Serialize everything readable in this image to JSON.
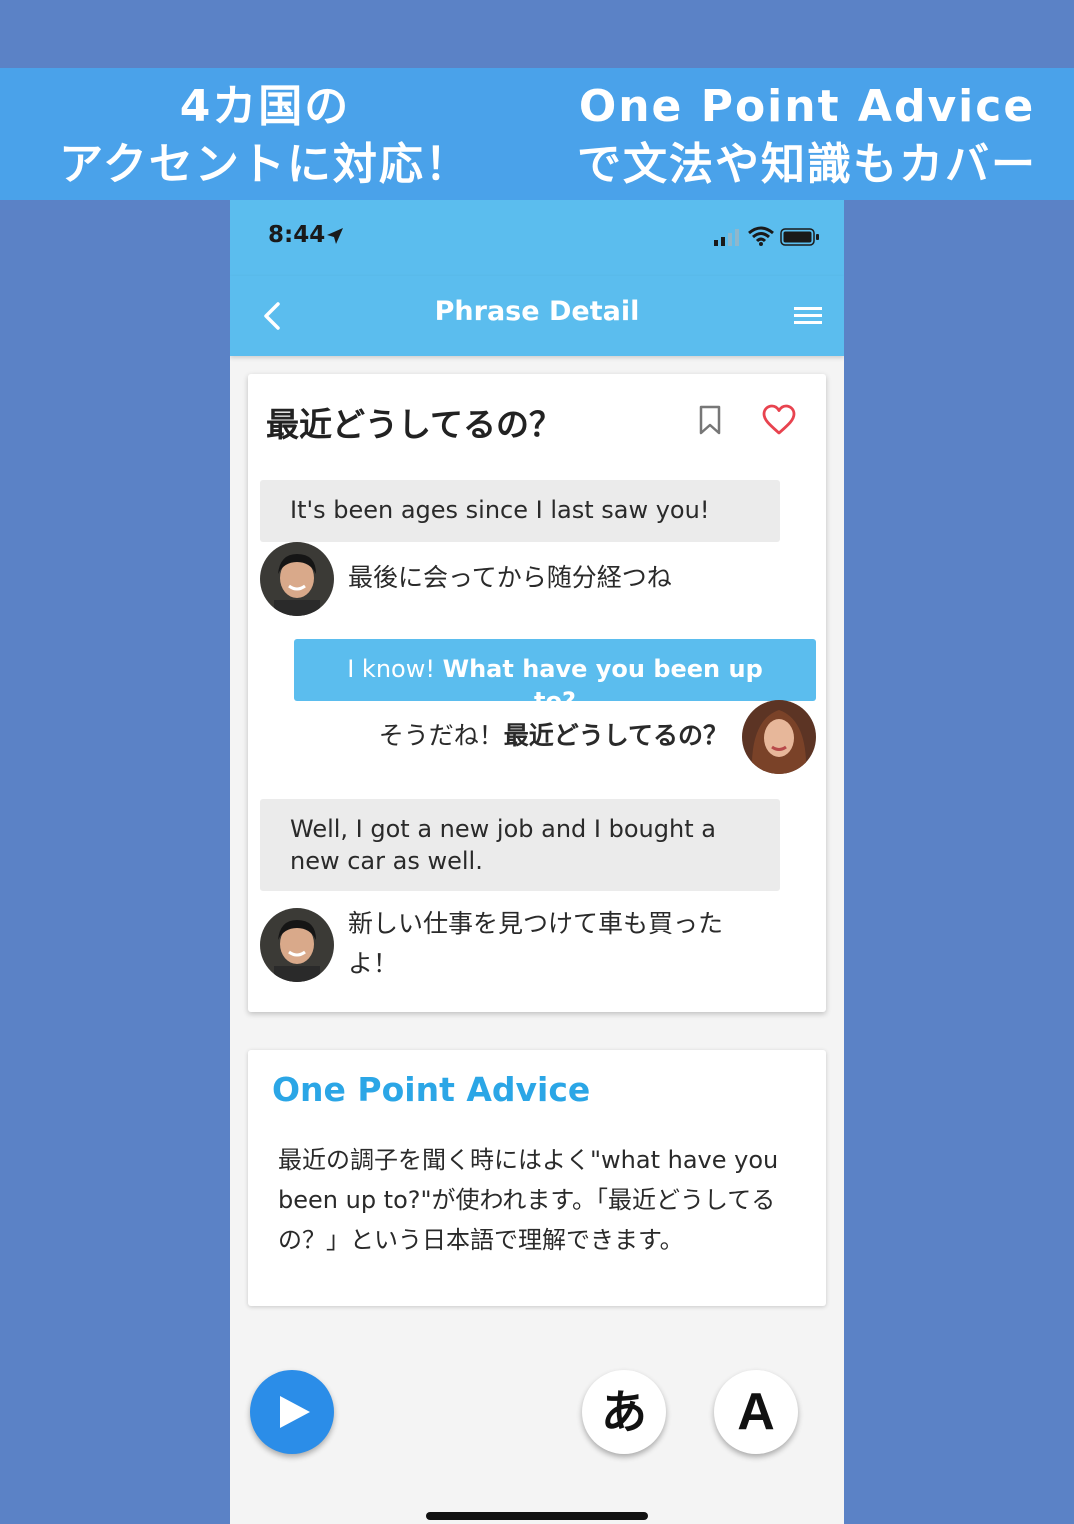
{
  "banner": {
    "left_line1": "4カ国の",
    "left_line2": "アクセントに対応！",
    "right_line1": "One Point Advice",
    "right_line2": "で文法や知識もカバー"
  },
  "status": {
    "time": "8:44"
  },
  "nav": {
    "title": "Phrase Detail"
  },
  "phrase": {
    "title": "最近どうしてるの？"
  },
  "dialog": [
    {
      "en": "It's been ages since I last saw you!",
      "ja": "最後に会ってから随分経つね"
    },
    {
      "en_plain": "I know! ",
      "en_strong": "What have you been up to?",
      "ja_plain": "そうだね！",
      "ja_strong": "最近どうしてるの？"
    },
    {
      "en": "Well, I got a new job and I bought a new car as well.",
      "ja": "新しい仕事を見つけて車も買ったよ！"
    }
  ],
  "advice": {
    "title": "One Point Advice",
    "body": "最近の調子を聞く時にはよく\"what have you been up to?\"が使われます。「最近どうしてるの？」という日本語で理解できます。"
  },
  "controls": {
    "ja_label": "あ",
    "en_label": "A"
  },
  "colors": {
    "background": "#5b82c6",
    "banner": "#4aa2ea",
    "header": "#5bbdee",
    "accent": "#2ba6e6",
    "play": "#2b8de8",
    "heart": "#e8434f"
  }
}
